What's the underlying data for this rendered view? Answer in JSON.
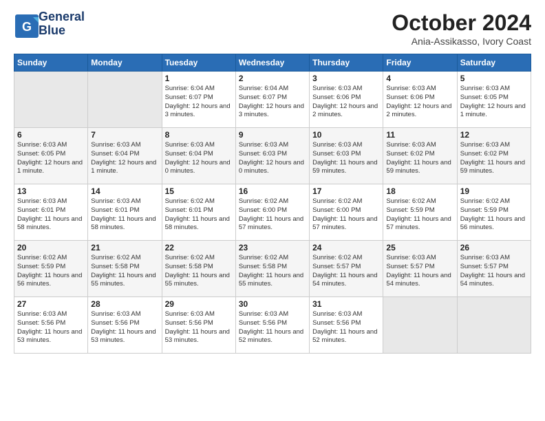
{
  "header": {
    "logo_line1": "General",
    "logo_line2": "Blue",
    "month_title": "October 2024",
    "subtitle": "Ania-Assikasso, Ivory Coast"
  },
  "days_of_week": [
    "Sunday",
    "Monday",
    "Tuesday",
    "Wednesday",
    "Thursday",
    "Friday",
    "Saturday"
  ],
  "weeks": [
    [
      {
        "day": "",
        "info": ""
      },
      {
        "day": "",
        "info": ""
      },
      {
        "day": "1",
        "info": "Sunrise: 6:04 AM\nSunset: 6:07 PM\nDaylight: 12 hours and 3 minutes."
      },
      {
        "day": "2",
        "info": "Sunrise: 6:04 AM\nSunset: 6:07 PM\nDaylight: 12 hours and 3 minutes."
      },
      {
        "day": "3",
        "info": "Sunrise: 6:03 AM\nSunset: 6:06 PM\nDaylight: 12 hours and 2 minutes."
      },
      {
        "day": "4",
        "info": "Sunrise: 6:03 AM\nSunset: 6:06 PM\nDaylight: 12 hours and 2 minutes."
      },
      {
        "day": "5",
        "info": "Sunrise: 6:03 AM\nSunset: 6:05 PM\nDaylight: 12 hours and 1 minute."
      }
    ],
    [
      {
        "day": "6",
        "info": "Sunrise: 6:03 AM\nSunset: 6:05 PM\nDaylight: 12 hours and 1 minute."
      },
      {
        "day": "7",
        "info": "Sunrise: 6:03 AM\nSunset: 6:04 PM\nDaylight: 12 hours and 1 minute."
      },
      {
        "day": "8",
        "info": "Sunrise: 6:03 AM\nSunset: 6:04 PM\nDaylight: 12 hours and 0 minutes."
      },
      {
        "day": "9",
        "info": "Sunrise: 6:03 AM\nSunset: 6:03 PM\nDaylight: 12 hours and 0 minutes."
      },
      {
        "day": "10",
        "info": "Sunrise: 6:03 AM\nSunset: 6:03 PM\nDaylight: 11 hours and 59 minutes."
      },
      {
        "day": "11",
        "info": "Sunrise: 6:03 AM\nSunset: 6:02 PM\nDaylight: 11 hours and 59 minutes."
      },
      {
        "day": "12",
        "info": "Sunrise: 6:03 AM\nSunset: 6:02 PM\nDaylight: 11 hours and 59 minutes."
      }
    ],
    [
      {
        "day": "13",
        "info": "Sunrise: 6:03 AM\nSunset: 6:01 PM\nDaylight: 11 hours and 58 minutes."
      },
      {
        "day": "14",
        "info": "Sunrise: 6:03 AM\nSunset: 6:01 PM\nDaylight: 11 hours and 58 minutes."
      },
      {
        "day": "15",
        "info": "Sunrise: 6:02 AM\nSunset: 6:01 PM\nDaylight: 11 hours and 58 minutes."
      },
      {
        "day": "16",
        "info": "Sunrise: 6:02 AM\nSunset: 6:00 PM\nDaylight: 11 hours and 57 minutes."
      },
      {
        "day": "17",
        "info": "Sunrise: 6:02 AM\nSunset: 6:00 PM\nDaylight: 11 hours and 57 minutes."
      },
      {
        "day": "18",
        "info": "Sunrise: 6:02 AM\nSunset: 5:59 PM\nDaylight: 11 hours and 57 minutes."
      },
      {
        "day": "19",
        "info": "Sunrise: 6:02 AM\nSunset: 5:59 PM\nDaylight: 11 hours and 56 minutes."
      }
    ],
    [
      {
        "day": "20",
        "info": "Sunrise: 6:02 AM\nSunset: 5:59 PM\nDaylight: 11 hours and 56 minutes."
      },
      {
        "day": "21",
        "info": "Sunrise: 6:02 AM\nSunset: 5:58 PM\nDaylight: 11 hours and 55 minutes."
      },
      {
        "day": "22",
        "info": "Sunrise: 6:02 AM\nSunset: 5:58 PM\nDaylight: 11 hours and 55 minutes."
      },
      {
        "day": "23",
        "info": "Sunrise: 6:02 AM\nSunset: 5:58 PM\nDaylight: 11 hours and 55 minutes."
      },
      {
        "day": "24",
        "info": "Sunrise: 6:02 AM\nSunset: 5:57 PM\nDaylight: 11 hours and 54 minutes."
      },
      {
        "day": "25",
        "info": "Sunrise: 6:03 AM\nSunset: 5:57 PM\nDaylight: 11 hours and 54 minutes."
      },
      {
        "day": "26",
        "info": "Sunrise: 6:03 AM\nSunset: 5:57 PM\nDaylight: 11 hours and 54 minutes."
      }
    ],
    [
      {
        "day": "27",
        "info": "Sunrise: 6:03 AM\nSunset: 5:56 PM\nDaylight: 11 hours and 53 minutes."
      },
      {
        "day": "28",
        "info": "Sunrise: 6:03 AM\nSunset: 5:56 PM\nDaylight: 11 hours and 53 minutes."
      },
      {
        "day": "29",
        "info": "Sunrise: 6:03 AM\nSunset: 5:56 PM\nDaylight: 11 hours and 53 minutes."
      },
      {
        "day": "30",
        "info": "Sunrise: 6:03 AM\nSunset: 5:56 PM\nDaylight: 11 hours and 52 minutes."
      },
      {
        "day": "31",
        "info": "Sunrise: 6:03 AM\nSunset: 5:56 PM\nDaylight: 11 hours and 52 minutes."
      },
      {
        "day": "",
        "info": ""
      },
      {
        "day": "",
        "info": ""
      }
    ]
  ]
}
